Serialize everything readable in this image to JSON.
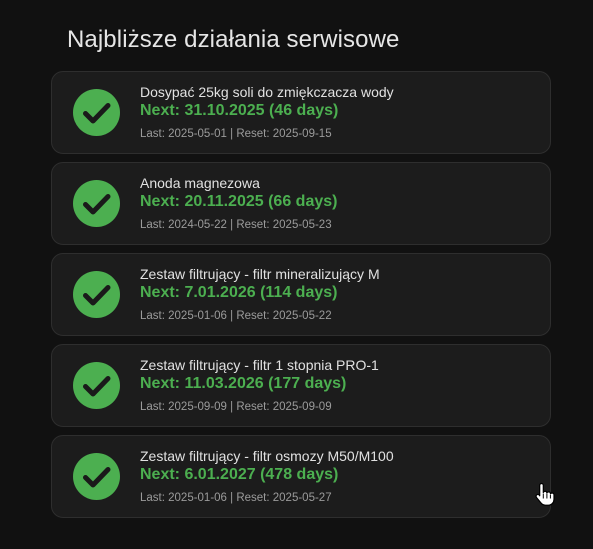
{
  "title": "Najbliższe działania serwisowe",
  "colors": {
    "background": "#111111",
    "card": "#1c1c1c",
    "accent": "#4caf50",
    "text": "#e1e1e1",
    "muted": "#9b9b9b"
  },
  "items": [
    {
      "name": "Dosypać 25kg soli do zmiękczacza wody",
      "next": "Next: 31.10.2025 (46 days)",
      "meta": "Last: 2025-05-01 | Reset: 2025-09-15",
      "status_icon": "check-circle-icon"
    },
    {
      "name": "Anoda magnezowa",
      "next": "Next: 20.11.2025 (66 days)",
      "meta": "Last: 2024-05-22 | Reset: 2025-05-23",
      "status_icon": "check-circle-icon"
    },
    {
      "name": "Zestaw filtrujący - filtr mineralizujący M",
      "next": "Next: 7.01.2026 (114 days)",
      "meta": "Last: 2025-01-06 | Reset: 2025-05-22",
      "status_icon": "check-circle-icon"
    },
    {
      "name": "Zestaw filtrujący - filtr 1 stopnia PRO-1",
      "next": "Next: 11.03.2026 (177 days)",
      "meta": "Last: 2025-09-09 | Reset: 2025-09-09",
      "status_icon": "check-circle-icon"
    },
    {
      "name": "Zestaw filtrujący - filtr osmozy M50/M100",
      "next": "Next: 6.01.2027 (478 days)",
      "meta": "Last: 2025-01-06 | Reset: 2025-05-27",
      "status_icon": "check-circle-icon"
    }
  ],
  "cursor": "hand-pointer-icon"
}
